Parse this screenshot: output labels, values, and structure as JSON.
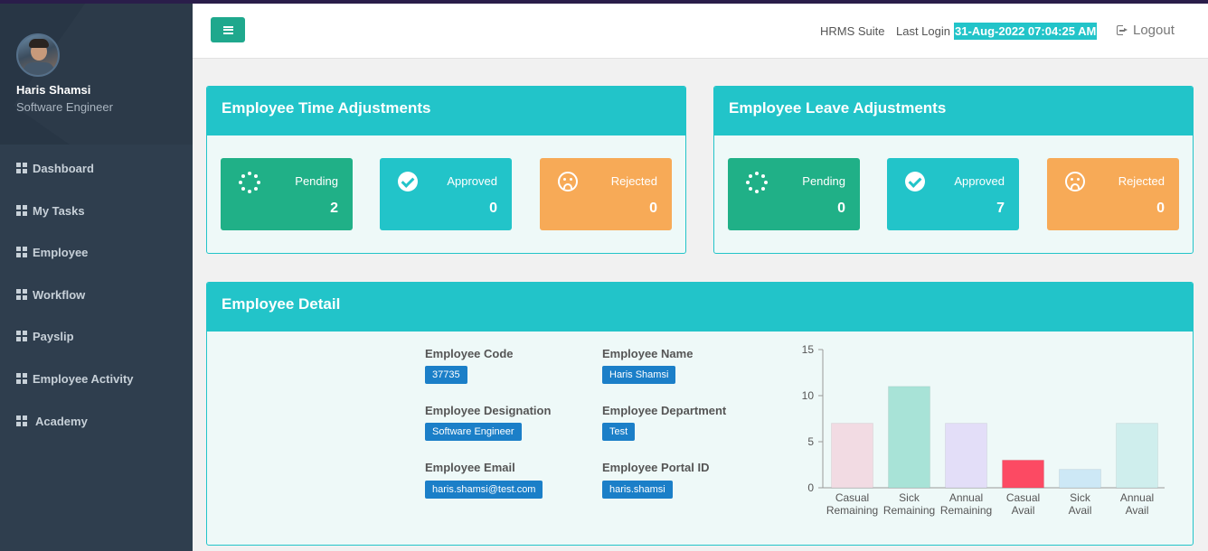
{
  "sidebar": {
    "user_name": "Haris Shamsi",
    "user_role": "Software Engineer",
    "items": [
      {
        "label": "Dashboard"
      },
      {
        "label": "My Tasks"
      },
      {
        "label": "Employee"
      },
      {
        "label": "Workflow"
      },
      {
        "label": "Payslip"
      },
      {
        "label": "Employee Activity"
      },
      {
        "label": "Academy"
      }
    ]
  },
  "header": {
    "app_name": "HRMS Suite",
    "last_login_label": "Last Login",
    "last_login_value": "31-Aug-2022 07:04:25 AM",
    "logout_label": "Logout"
  },
  "time_adjustments": {
    "title": "Employee Time Adjustments",
    "pending_label": "Pending",
    "pending_value": "2",
    "approved_label": "Approved",
    "approved_value": "0",
    "rejected_label": "Rejected",
    "rejected_value": "0"
  },
  "leave_adjustments": {
    "title": "Employee Leave Adjustments",
    "pending_label": "Pending",
    "pending_value": "0",
    "approved_label": "Approved",
    "approved_value": "7",
    "rejected_label": "Rejected",
    "rejected_value": "0"
  },
  "detail": {
    "title": "Employee Detail",
    "code_label": "Employee Code",
    "code_value": "37735",
    "name_label": "Employee Name",
    "name_value": "Haris Shamsi",
    "designation_label": "Employee Designation",
    "designation_value": "Software Engineer",
    "department_label": "Employee Department",
    "department_value": "Test",
    "email_label": "Employee Email",
    "email_value": "haris.shamsi@test.com",
    "portal_label": "Employee Portal ID",
    "portal_value": "haris.shamsi"
  },
  "colors": {
    "accent": "#22c4c9",
    "pending": "#20b087",
    "rejected": "#f7aa57",
    "badge": "#1b7fc8",
    "sidebar": "#2f3e4e"
  },
  "chart_data": {
    "type": "bar",
    "categories": [
      [
        "Casual",
        "Remaining"
      ],
      [
        "Sick",
        "Remaining"
      ],
      [
        "Annual",
        "Remaining"
      ],
      [
        "Casual",
        "Avail"
      ],
      [
        "Sick",
        "Avail"
      ],
      [
        "Annual",
        "Avail"
      ]
    ],
    "values": [
      7,
      11,
      7,
      3,
      2,
      7
    ],
    "colors": [
      "#f2dbe3",
      "#a8e3d7",
      "#e3def8",
      "#fc4a63",
      "#cde8f6",
      "#cfeeed"
    ],
    "ylim": [
      0,
      15
    ],
    "yticks": [
      "0",
      "5",
      "10",
      "15"
    ],
    "grid": false
  }
}
